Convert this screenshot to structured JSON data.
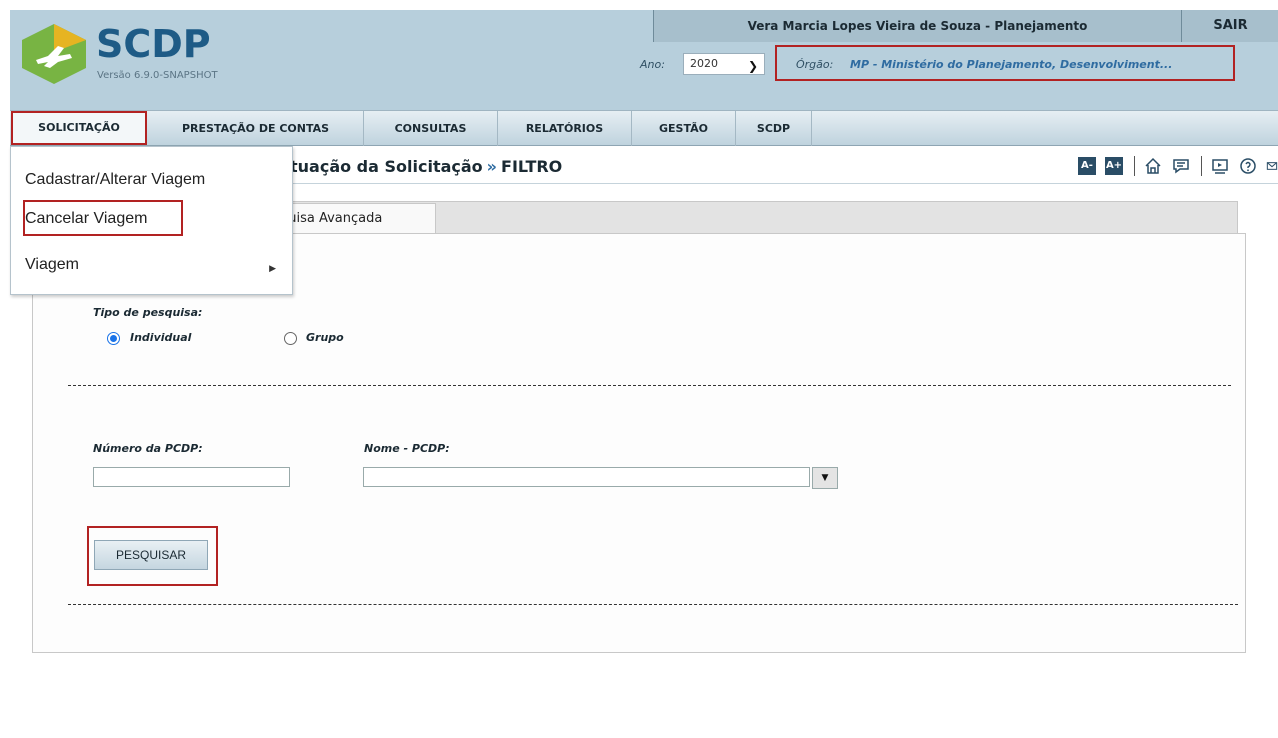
{
  "app": {
    "name": "SCDP",
    "version": "Versão 6.9.0-SNAPSHOT"
  },
  "header": {
    "user": "Vera Marcia Lopes Vieira de Souza - Planejamento",
    "logout": "SAIR",
    "year_label": "Ano:",
    "year_value": "2020",
    "org_label": "Órgão:",
    "org_value": "MP - Ministério do Planejamento, Desenvolviment..."
  },
  "nav": {
    "items": [
      {
        "label": "SOLICITAÇÃO"
      },
      {
        "label": "PRESTAÇÃO DE CONTAS"
      },
      {
        "label": "CONSULTAS"
      },
      {
        "label": "RELATÓRIOS"
      },
      {
        "label": "GESTÃO"
      },
      {
        "label": "SCDP"
      }
    ]
  },
  "dropdown": {
    "items": [
      {
        "label": "Cadastrar/Alterar Viagem"
      },
      {
        "label": "Cancelar Viagem"
      },
      {
        "label": "Viagem"
      }
    ]
  },
  "title": {
    "part1": "tuação da Solicitação",
    "separator": "»",
    "part2": "FILTRO"
  },
  "tools": {
    "font_decrease": "A-",
    "font_increase": "A+"
  },
  "tab": {
    "label": "quisa Avançada"
  },
  "form": {
    "search_type_label": "Tipo de pesquisa:",
    "radio_individual": "Individual",
    "radio_group": "Grupo",
    "pcdp_number_label": "Número da PCDP:",
    "pcdp_name_label": "Nome - PCDP:",
    "pcdp_number_value": "",
    "pcdp_name_value": "",
    "search_button": "PESQUISAR"
  },
  "colors": {
    "accent": "#2f6ca1",
    "highlight": "#b22222",
    "header_bg": "#b7cfdc"
  }
}
